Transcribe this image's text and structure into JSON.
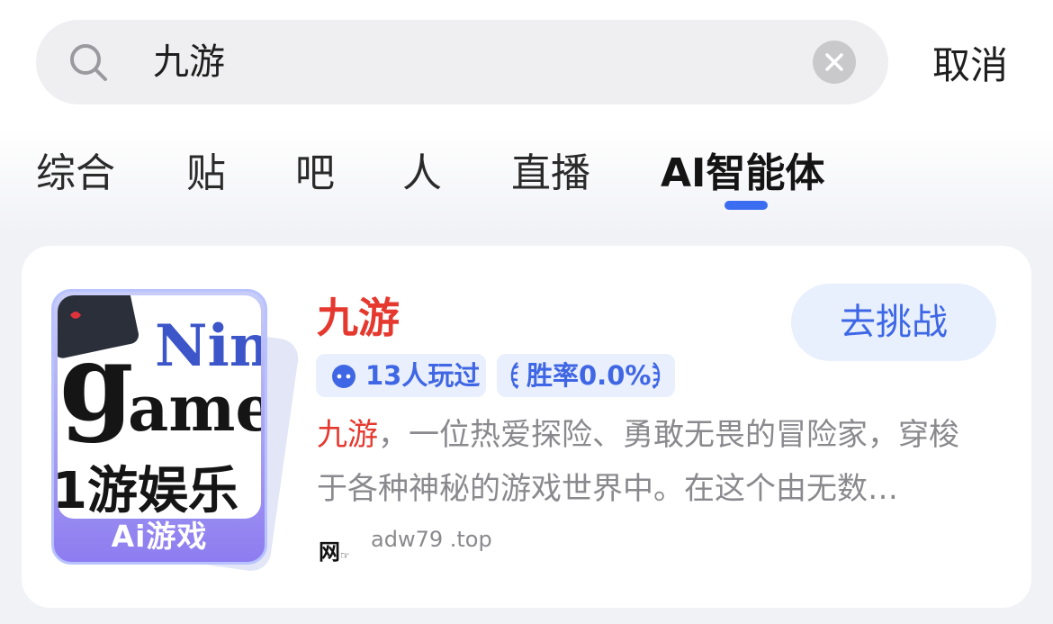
{
  "search": {
    "query": "九游",
    "cancel_label": "取消"
  },
  "tabs": [
    {
      "label": "综合"
    },
    {
      "label": "贴"
    },
    {
      "label": "吧"
    },
    {
      "label": "人"
    },
    {
      "label": "直播"
    },
    {
      "label": "AI智能体",
      "active": true
    }
  ],
  "card": {
    "title": "九游",
    "challenge_label": "去挑战",
    "played_count": "13人玩过",
    "win_rate": "胜率0.0%",
    "description_highlight": "九游",
    "description_rest": "，一位热爱探险、勇敢无畏的冒险家，穿梭于各种神秘的游戏世界中。在这个由无数…",
    "cover_label": "Ai游戏",
    "cover_art_text": {
      "line1": "Nin",
      "line2": "g",
      "line3": "ame",
      "line4": "1游娱乐"
    },
    "source_logo": "网",
    "source_text": "adw79 .top"
  },
  "colors": {
    "accent_blue": "#3a6df0",
    "title_red": "#e5392f",
    "badge_bg": "#e9effd",
    "badge_text": "#3f66e4"
  }
}
